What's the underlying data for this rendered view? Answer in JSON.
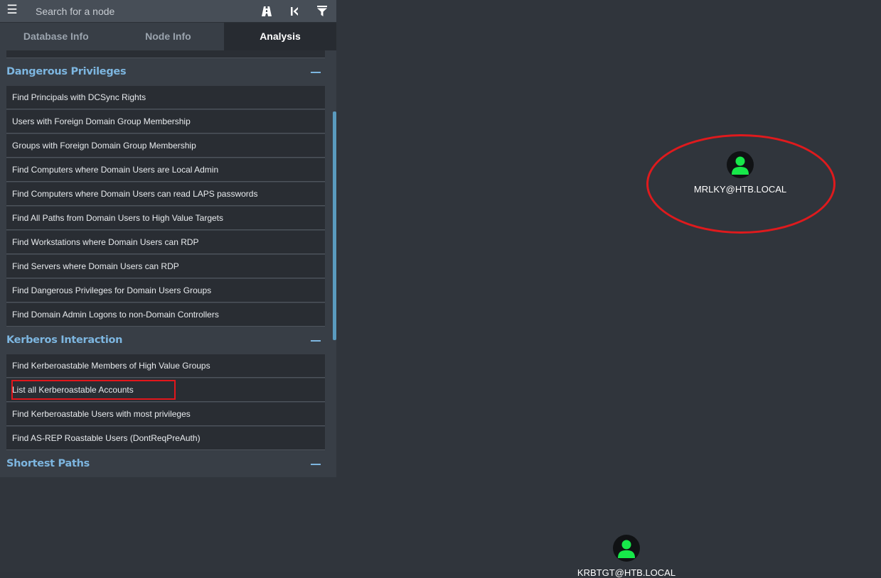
{
  "search": {
    "placeholder": "Search for a node"
  },
  "toolbar": {
    "menu_icon": "hamburger-icon",
    "pathfinding_icon": "road-icon",
    "back_icon": "step-back-icon",
    "filter_icon": "filter-icon"
  },
  "tabs": [
    {
      "label": "Database Info",
      "active": false
    },
    {
      "label": "Node Info",
      "active": false
    },
    {
      "label": "Analysis",
      "active": true
    }
  ],
  "sections": [
    {
      "title": "Dangerous Privileges",
      "items": [
        "Find Principals with DCSync Rights",
        "Users with Foreign Domain Group Membership",
        "Groups with Foreign Domain Group Membership",
        "Find Computers where Domain Users are Local Admin",
        "Find Computers where Domain Users can read LAPS passwords",
        "Find All Paths from Domain Users to High Value Targets",
        "Find Workstations where Domain Users can RDP",
        "Find Servers where Domain Users can RDP",
        "Find Dangerous Privileges for Domain Users Groups",
        "Find Domain Admin Logons to non-Domain Controllers"
      ]
    },
    {
      "title": "Kerberos Interaction",
      "items": [
        "Find Kerberoastable Members of High Value Groups",
        "List all Kerberoastable Accounts",
        "Find Kerberoastable Users with most privileges",
        "Find AS-REP Roastable Users (DontReqPreAuth)"
      ]
    },
    {
      "title": "Shortest Paths",
      "items": []
    }
  ],
  "graph": {
    "nodes": [
      {
        "label": "MRLKY@HTB.LOCAL",
        "type": "user",
        "highlighted": true
      },
      {
        "label": "KRBTGT@HTB.LOCAL",
        "type": "user",
        "highlighted": false
      }
    ]
  },
  "colors": {
    "accent": "#7db6e0",
    "highlight": "#e2161b",
    "user_node": "#17e84a"
  }
}
